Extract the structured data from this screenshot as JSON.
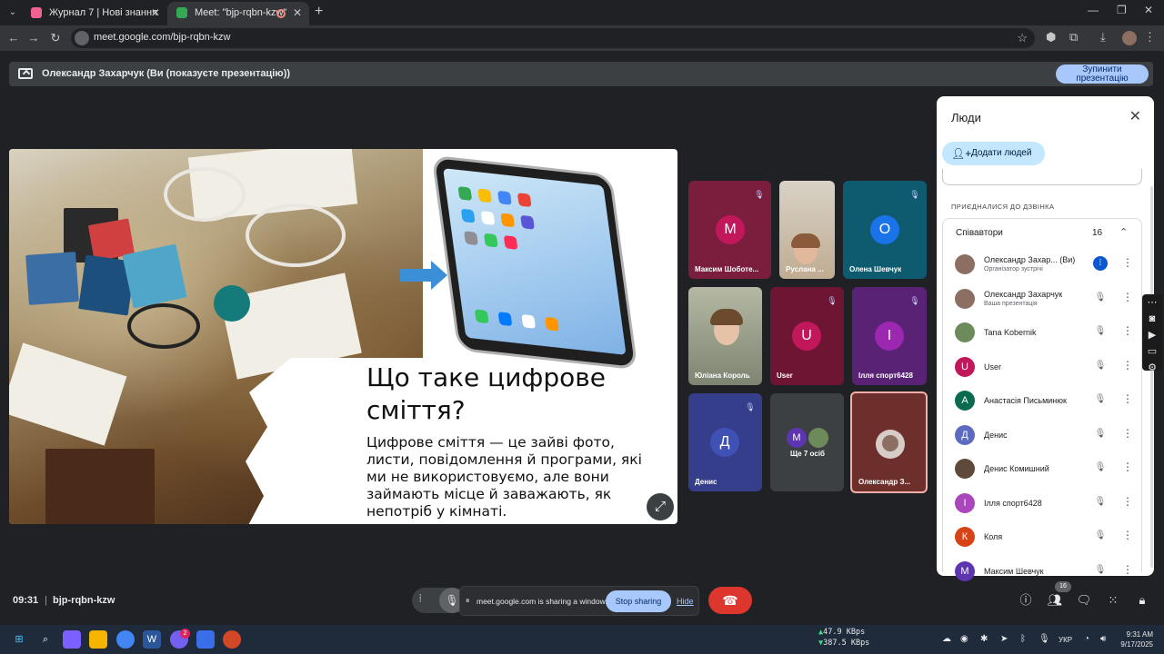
{
  "browser": {
    "tabs": [
      {
        "title": "Журнал 7 | Нові знання"
      },
      {
        "title": "Meet: \"bjp-rqbn-kzw\""
      }
    ],
    "url": "meet.google.com/bjp-rqbn-kzw"
  },
  "banner": {
    "text": "Олександр Захарчук (Ви (показуєте презентацію))",
    "stop_label": "Зупинити презентацію"
  },
  "slide": {
    "title": "Що таке цифрове сміття?",
    "body": "Цифрове сміття — це зайві фото, листи, повідомлення й програми, які ми не використовуємо, але вони займають місце й заважають, як непотріб у кімнаті."
  },
  "tiles": [
    {
      "name": "Максим Шоботе...",
      "initial": "М",
      "color": "#c2185b",
      "bg": "#7b1e3e",
      "muted": true
    },
    {
      "name": "Руслана ...",
      "initial": "",
      "bg": "#c9b8a3",
      "muted": false
    },
    {
      "name": "Олена Шевчук",
      "initial": "О",
      "color": "#1a73e8",
      "bg": "#0e5a6e",
      "muted": true
    },
    {
      "name": "Юліана Король",
      "initial": "",
      "bg": "#9aa38f",
      "muted": false
    },
    {
      "name": "User",
      "initial": "U",
      "color": "#c2185b",
      "bg": "#6e1534",
      "muted": true
    },
    {
      "name": "Ілля спорт6428",
      "initial": "І",
      "color": "#9c27b0",
      "bg": "#5a2275",
      "muted": true
    },
    {
      "name": "Денис",
      "initial": "Д",
      "color": "#3f51b5",
      "bg": "#353e8a",
      "muted": true
    },
    {
      "name": "Ще 7 осіб",
      "initial": "М",
      "color": "#5e35b1",
      "bg": "#3c4043",
      "muted": false
    },
    {
      "name": "Олександр З...",
      "initial": "",
      "bg": "#6d2f2b",
      "muted": false
    }
  ],
  "people_panel": {
    "title": "Люди",
    "add_label": "Додати людей",
    "joined_label": "ПРИЄДНАЛИСЯ ДО ДЗВІНКА",
    "section_title": "Співавтори",
    "section_count": "16",
    "participants": [
      {
        "name": "Олександр Захар...  (Ви)",
        "sub": "Організатор зустрічі",
        "initial": "",
        "color": "#8d6e63",
        "mic": "live"
      },
      {
        "name": "Олександр Захарчук",
        "sub": "Ваша презентація",
        "initial": "",
        "color": "#8d6e63",
        "mic": "off"
      },
      {
        "name": "Tana Kobernik",
        "sub": "",
        "initial": "",
        "color": "#6d8b5a",
        "mic": "off"
      },
      {
        "name": "User",
        "sub": "",
        "initial": "U",
        "color": "#c2185b",
        "mic": "off"
      },
      {
        "name": "Анастасія Письминюк",
        "sub": "",
        "initial": "А",
        "color": "#0b6b4f",
        "mic": "off"
      },
      {
        "name": "Денис",
        "sub": "",
        "initial": "Д",
        "color": "#5c6bc0",
        "mic": "off"
      },
      {
        "name": "Денис Комишний",
        "sub": "",
        "initial": "",
        "color": "#5d4a3a",
        "mic": "off"
      },
      {
        "name": "Ілля спорт6428",
        "sub": "",
        "initial": "І",
        "color": "#ab47bc",
        "mic": "off"
      },
      {
        "name": "Коля",
        "sub": "",
        "initial": "К",
        "color": "#d84315",
        "mic": "off"
      },
      {
        "name": "Максим Шевчук",
        "sub": "",
        "initial": "М",
        "color": "#5e35b1",
        "mic": "off"
      }
    ]
  },
  "bottom_bar": {
    "time": "09:31",
    "code": "bjp-rqbn-kzw",
    "share_text": "meet.google.com is sharing a window.",
    "stop_sharing": "Stop sharing",
    "hide": "Hide",
    "people_count": "16"
  },
  "taskbar": {
    "net_up": "47.9 KBps",
    "net_down": "387.5 KBps",
    "lang": "УКР",
    "time": "9:31 AM",
    "date": "9/17/2025",
    "messenger_badge": "2"
  }
}
